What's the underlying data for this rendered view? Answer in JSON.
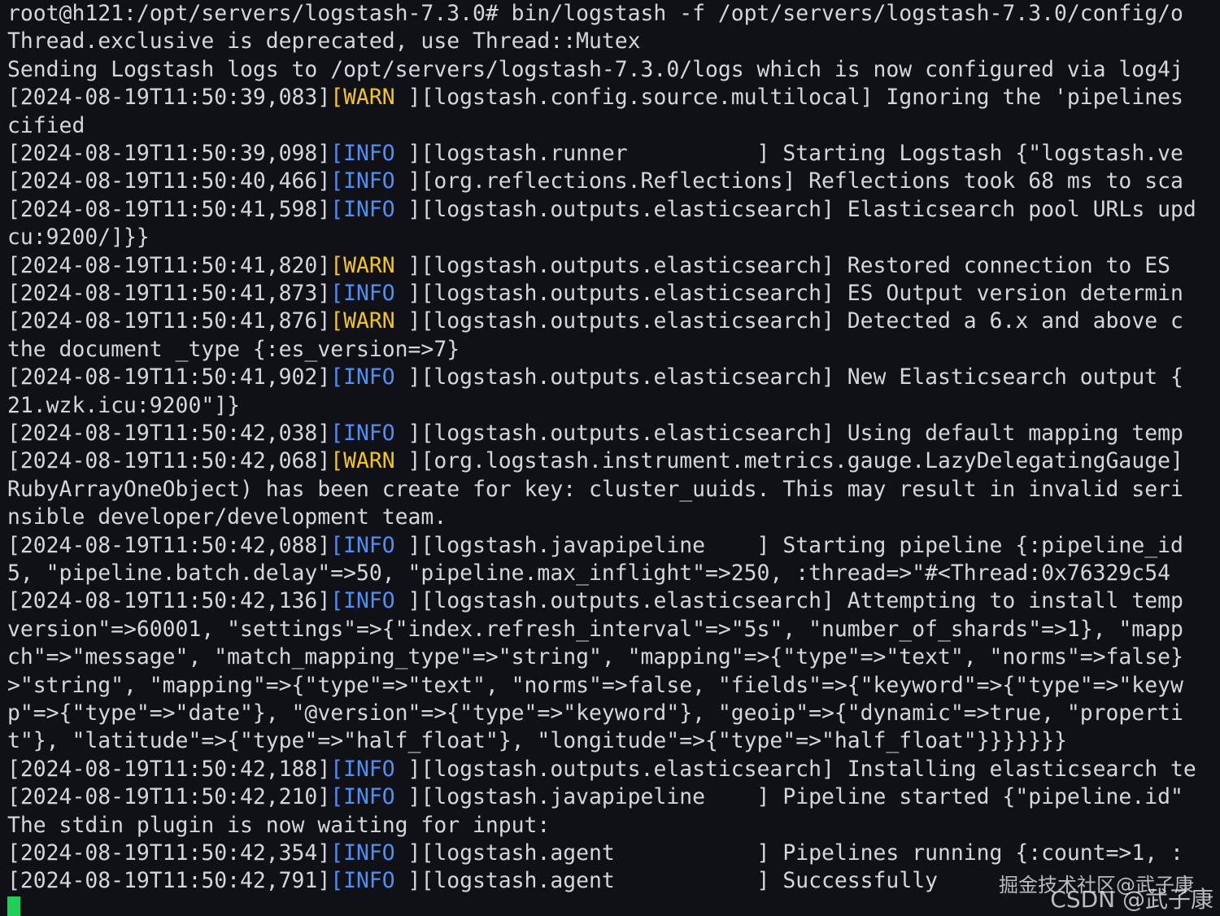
{
  "terminal": {
    "lines": [
      {
        "text": "root@h121:/opt/servers/logstash-7.3.0# bin/logstash -f /opt/servers/logstash-7.3.0/config/o"
      },
      {
        "text": "Thread.exclusive is deprecated, use Thread::Mutex"
      },
      {
        "text": "Sending Logstash logs to /opt/servers/logstash-7.3.0/logs which is now configured via log4j"
      },
      {
        "ts": "[2024-08-19T11:50:39,083]",
        "level": "[WARN",
        "level_type": "warn",
        "rest": " ][logstash.config.source.multilocal] Ignoring the 'pipelines"
      },
      {
        "text": "cified"
      },
      {
        "ts": "[2024-08-19T11:50:39,098]",
        "level": "[INFO",
        "level_type": "info",
        "rest": " ][logstash.runner          ] Starting Logstash {\"logstash.ve"
      },
      {
        "ts": "[2024-08-19T11:50:40,466]",
        "level": "[INFO",
        "level_type": "info",
        "rest": " ][org.reflections.Reflections] Reflections took 68 ms to sca"
      },
      {
        "ts": "[2024-08-19T11:50:41,598]",
        "level": "[INFO",
        "level_type": "info",
        "rest": " ][logstash.outputs.elasticsearch] Elasticsearch pool URLs upd"
      },
      {
        "text": "cu:9200/]}}"
      },
      {
        "ts": "[2024-08-19T11:50:41,820]",
        "level": "[WARN",
        "level_type": "warn",
        "rest": " ][logstash.outputs.elasticsearch] Restored connection to ES"
      },
      {
        "ts": "[2024-08-19T11:50:41,873]",
        "level": "[INFO",
        "level_type": "info",
        "rest": " ][logstash.outputs.elasticsearch] ES Output version determin"
      },
      {
        "ts": "[2024-08-19T11:50:41,876]",
        "level": "[WARN",
        "level_type": "warn",
        "rest": " ][logstash.outputs.elasticsearch] Detected a 6.x and above c"
      },
      {
        "text": "the document _type {:es_version=>7}"
      },
      {
        "ts": "[2024-08-19T11:50:41,902]",
        "level": "[INFO",
        "level_type": "info",
        "rest": " ][logstash.outputs.elasticsearch] New Elasticsearch output {"
      },
      {
        "text": "21.wzk.icu:9200\"]}"
      },
      {
        "ts": "[2024-08-19T11:50:42,038]",
        "level": "[INFO",
        "level_type": "info",
        "rest": " ][logstash.outputs.elasticsearch] Using default mapping temp"
      },
      {
        "ts": "[2024-08-19T11:50:42,068]",
        "level": "[WARN",
        "level_type": "warn",
        "rest": " ][org.logstash.instrument.metrics.gauge.LazyDelegatingGauge]"
      },
      {
        "text": "RubyArrayOneObject) has been create for key: cluster_uuids. This may result in invalid seri"
      },
      {
        "text": "nsible developer/development team."
      },
      {
        "ts": "[2024-08-19T11:50:42,088]",
        "level": "[INFO",
        "level_type": "info",
        "rest": " ][logstash.javapipeline    ] Starting pipeline {:pipeline_id"
      },
      {
        "text": "5, \"pipeline.batch.delay\"=>50, \"pipeline.max_inflight\"=>250, :thread=>\"#<Thread:0x76329c54"
      },
      {
        "ts": "[2024-08-19T11:50:42,136]",
        "level": "[INFO",
        "level_type": "info",
        "rest": " ][logstash.outputs.elasticsearch] Attempting to install temp"
      },
      {
        "text": "version\"=>60001, \"settings\"=>{\"index.refresh_interval\"=>\"5s\", \"number_of_shards\"=>1}, \"mapp"
      },
      {
        "text": "ch\"=>\"message\", \"match_mapping_type\"=>\"string\", \"mapping\"=>{\"type\"=>\"text\", \"norms\"=>false}"
      },
      {
        "text": ">\"string\", \"mapping\"=>{\"type\"=>\"text\", \"norms\"=>false, \"fields\"=>{\"keyword\"=>{\"type\"=>\"keyw"
      },
      {
        "text": "p\"=>{\"type\"=>\"date\"}, \"@version\"=>{\"type\"=>\"keyword\"}, \"geoip\"=>{\"dynamic\"=>true, \"properti"
      },
      {
        "text": "t\"}, \"latitude\"=>{\"type\"=>\"half_float\"}, \"longitude\"=>{\"type\"=>\"half_float\"}}}}}}}"
      },
      {
        "ts": "[2024-08-19T11:50:42,188]",
        "level": "[INFO",
        "level_type": "info",
        "rest": " ][logstash.outputs.elasticsearch] Installing elasticsearch te"
      },
      {
        "ts": "[2024-08-19T11:50:42,210]",
        "level": "[INFO",
        "level_type": "info",
        "rest": " ][logstash.javapipeline    ] Pipeline started {\"pipeline.id\""
      },
      {
        "text": "The stdin plugin is now waiting for input:"
      },
      {
        "ts": "[2024-08-19T11:50:42,354]",
        "level": "[INFO",
        "level_type": "info",
        "rest": " ][logstash.agent           ] Pipelines running {:count=>1, :"
      },
      {
        "ts": "[2024-08-19T11:50:42,791]",
        "level": "[INFO",
        "level_type": "info",
        "rest": " ][logstash.agent           ] Successfully"
      }
    ]
  },
  "watermark": {
    "line1": "掘金技术社区@武子康",
    "line2": "CSDN @武子康"
  },
  "colors": {
    "background": "#0f1116",
    "text": "#d3d6dc",
    "info": "#4f8ff7",
    "warn": "#f5c518",
    "cursor": "#1fcf5c"
  }
}
